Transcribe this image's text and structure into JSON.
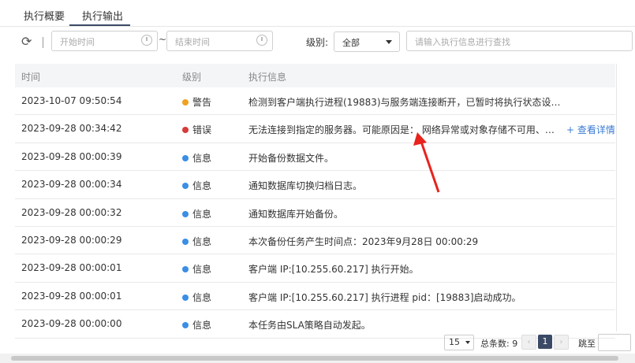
{
  "tabs": [
    {
      "label": "执行概要"
    },
    {
      "label": "执行输出"
    }
  ],
  "toolbar": {
    "start_placeholder": "开始时间",
    "end_placeholder": "结束时间",
    "tilde": "~",
    "level_label": "级别:",
    "level_selected": "全部",
    "search_placeholder": "请输入执行信息进行查找"
  },
  "table": {
    "headers": [
      "时间",
      "级别",
      "执行信息"
    ],
    "rows": [
      {
        "time": "2023-10-07 09:50:54",
        "level": "警告",
        "level_color": "#f0a020",
        "message": "检测到客户端执行进程(19883)与服务端连接断开，已暂时将执行状态设置…"
      },
      {
        "time": "2023-09-28 00:34:42",
        "level": "错误",
        "level_color": "#d93a3a",
        "message": "无法连接到指定的服务器。可能原因是： 网络异常或对象存储不可用、主…",
        "detail_link": "+ 查看详情"
      },
      {
        "time": "2023-09-28 00:00:39",
        "level": "信息",
        "level_color": "#3a8ee6",
        "message": "开始备份数据文件。"
      },
      {
        "time": "2023-09-28 00:00:34",
        "level": "信息",
        "level_color": "#3a8ee6",
        "message": "通知数据库切换归档日志。"
      },
      {
        "time": "2023-09-28 00:00:32",
        "level": "信息",
        "level_color": "#3a8ee6",
        "message": "通知数据库开始备份。"
      },
      {
        "time": "2023-09-28 00:00:29",
        "level": "信息",
        "level_color": "#3a8ee6",
        "message": "本次备份任务产生时间点：2023年9月28日 00:00:29"
      },
      {
        "time": "2023-09-28 00:00:01",
        "level": "信息",
        "level_color": "#3a8ee6",
        "message": "客户端 IP:[10.255.60.217] 执行开始。"
      },
      {
        "time": "2023-09-28 00:00:01",
        "level": "信息",
        "level_color": "#3a8ee6",
        "message": "客户端 IP:[10.255.60.217] 执行进程 pid：[19883]启动成功。"
      },
      {
        "time": "2023-09-28 00:00:00",
        "level": "信息",
        "level_color": "#3a8ee6",
        "message": "本任务由SLA策略自动发起。"
      }
    ]
  },
  "pagination": {
    "page_size": "15",
    "total_label": "总条数: 9",
    "prev": "‹",
    "current_page": "1",
    "next": "›",
    "jump_label": "跳至"
  },
  "colors": {
    "accent": "#3a4a66",
    "link": "#3a7bd5",
    "annotation_arrow": "#e8231d"
  }
}
